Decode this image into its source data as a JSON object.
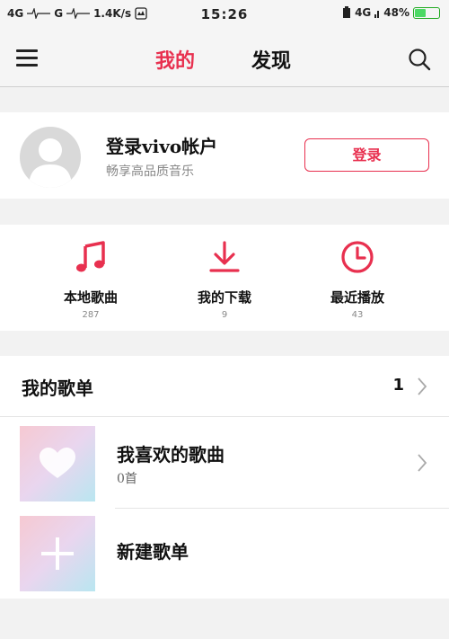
{
  "status_bar": {
    "sim1": "4G",
    "sim2": "G",
    "speed": "1.4K/s",
    "time": "15:26",
    "network": "4G",
    "battery_text": "48%",
    "battery_level": 0.48
  },
  "app_bar": {
    "tab_mine": "我的",
    "tab_discover": "发现"
  },
  "login_card": {
    "title": "登录vivo帐户",
    "subtitle": "畅享高品质音乐",
    "button": "登录"
  },
  "shortcuts": [
    {
      "label": "本地歌曲",
      "count": "287",
      "icon": "music-note-icon"
    },
    {
      "label": "我的下载",
      "count": "9",
      "icon": "download-icon"
    },
    {
      "label": "最近播放",
      "count": "43",
      "icon": "clock-icon"
    }
  ],
  "playlists": {
    "title": "我的歌单",
    "count": "1",
    "items": [
      {
        "name": "我喜欢的歌曲",
        "songs": "0首",
        "icon": "heart-icon"
      },
      {
        "name": "新建歌单",
        "icon": "plus-icon"
      }
    ]
  },
  "colors": {
    "accent": "#e8304f"
  }
}
